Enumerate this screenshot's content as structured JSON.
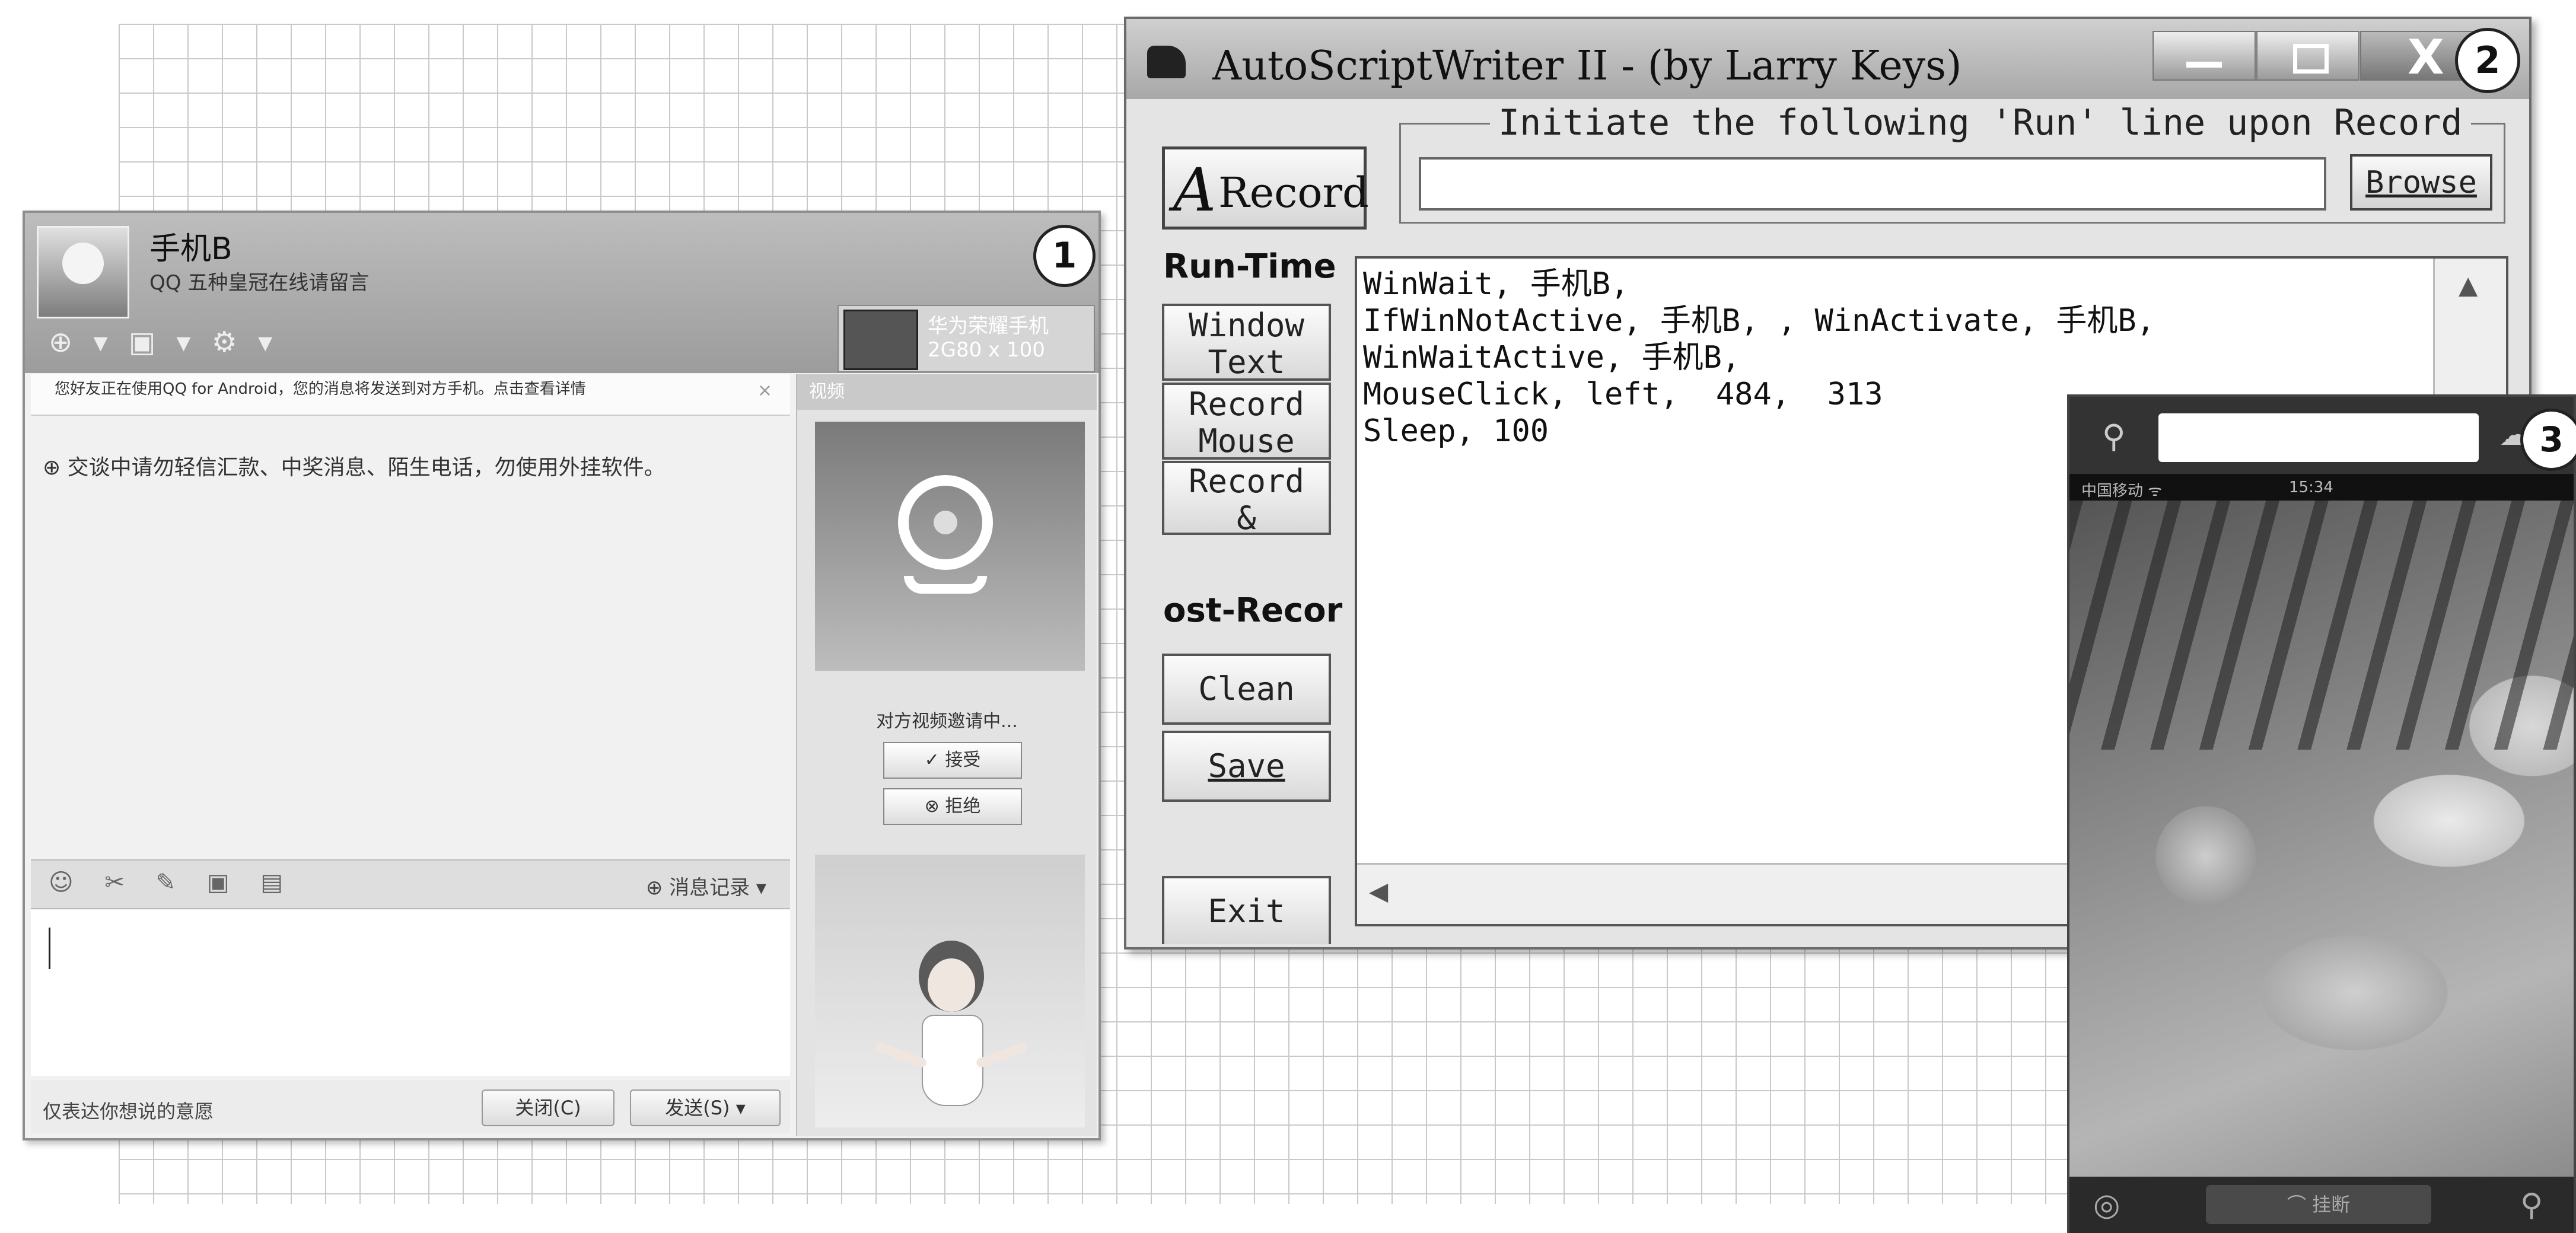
{
  "window1": {
    "number": "1",
    "contact_name": "手机B",
    "contact_status": "QQ 五种皇冠在线请留言",
    "toolbar_icons": "⊕ ▾ ▣ ▾ ⚙ ▾",
    "device": {
      "name": "华为荣耀手机",
      "resolution": "2G80 x 100"
    },
    "notice": "您好友正在使用QQ for Android，您的消息将发送到对方手机。点击查看详情",
    "notice_close": "×",
    "warning": "⊕ 交谈中请勿轻信汇款、中奖消息、陌生电话，勿使用外挂软件。",
    "toolbar2_icons": "☺ ✂ ✎ ▣ ▤",
    "history_label": "⊕ 消息记录 ▾",
    "footer_tip": "仅表达你想说的意愿",
    "close_button": "关闭(C)",
    "send_button": "发送(S) ▾",
    "right_panel_title": "视频",
    "waiting_text": "对方视频邀请中...",
    "accept_button": "✓ 接受",
    "reject_button": "⊗ 拒绝"
  },
  "window2": {
    "number": "2",
    "title": "AutoScriptWriter II - (by Larry Keys)",
    "close_glyph": "X",
    "record_letter": "A",
    "record_label": "Record",
    "run_group_label": "Initiate the following 'Run' line upon Record",
    "run_input_value": "",
    "browse_button": "Browse",
    "runtime_label": "Run-Time",
    "window_text_button": "Window\nText",
    "record_mouse_button": "Record\nMouse",
    "record_switch_button": "Record\n&\nSwitch",
    "post_record_label": "ost-Recor",
    "clean_button": "Clean",
    "save_button": "Save",
    "exit_button": "Exit",
    "script": "WinWait, 手机B,\nIfWinNotActive, 手机B, , WinActivate, 手机B,\nWinWaitActive, 手机B,\nMouseClick, left,  484,  313\nSleep, 100",
    "scroll_up": "▲",
    "scroll_left": "◀"
  },
  "window3": {
    "number": "3",
    "status_carrier": "中国移动 ᯤ",
    "status_time": "15:34",
    "bottom_button": "⌒ 挂断",
    "pin_icon": "⚲",
    "chat_icon": "☁",
    "bottom_left_icon": "◎",
    "bottom_right_icon": "⚲"
  }
}
